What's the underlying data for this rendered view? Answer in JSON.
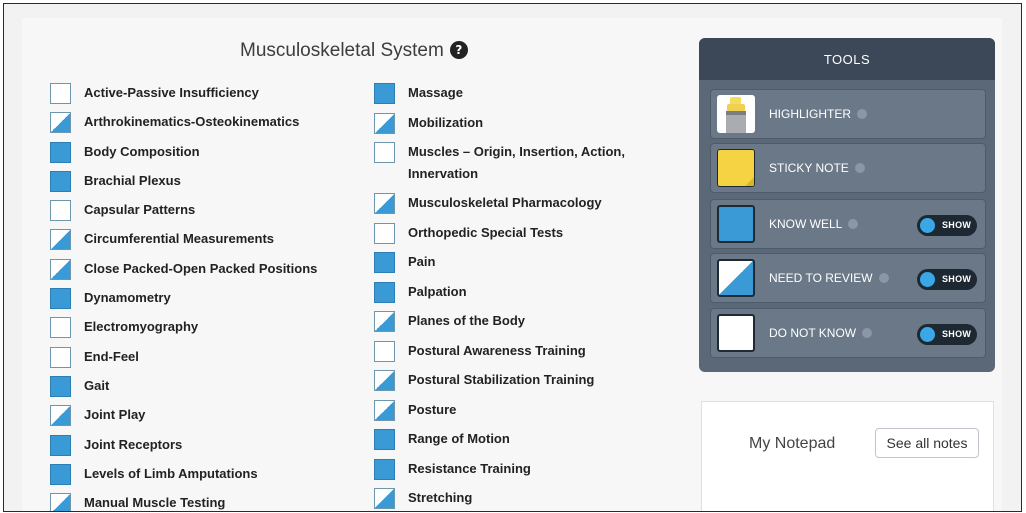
{
  "section": {
    "title": "Musculoskeletal System",
    "help_glyph": "?"
  },
  "topics_col1": [
    {
      "label": "Active-Passive Insufficiency",
      "status": "dont"
    },
    {
      "label": "Arthrokinematics-Osteokinematics",
      "status": "review"
    },
    {
      "label": "Body Composition",
      "status": "know"
    },
    {
      "label": "Brachial Plexus",
      "status": "know"
    },
    {
      "label": "Capsular Patterns",
      "status": "dont"
    },
    {
      "label": "Circumferential Measurements",
      "status": "review"
    },
    {
      "label": "Close Packed-Open Packed Positions",
      "status": "review"
    },
    {
      "label": "Dynamometry",
      "status": "know"
    },
    {
      "label": "Electromyography",
      "status": "dont"
    },
    {
      "label": "End-Feel",
      "status": "dont"
    },
    {
      "label": "Gait",
      "status": "know"
    },
    {
      "label": "Joint Play",
      "status": "review"
    },
    {
      "label": "Joint Receptors",
      "status": "know"
    },
    {
      "label": "Levels of Limb Amputations",
      "status": "know"
    },
    {
      "label": "Manual Muscle Testing",
      "status": "review"
    }
  ],
  "topics_col2": [
    {
      "label": "Massage",
      "status": "know"
    },
    {
      "label": "Mobilization",
      "status": "review"
    },
    {
      "label": "Muscles – Origin, Insertion, Action, Innervation",
      "status": "dont"
    },
    {
      "label": "Musculoskeletal Pharmacology",
      "status": "review"
    },
    {
      "label": "Orthopedic Special Tests",
      "status": "dont"
    },
    {
      "label": "Pain",
      "status": "know"
    },
    {
      "label": "Palpation",
      "status": "know"
    },
    {
      "label": "Planes of the Body",
      "status": "review"
    },
    {
      "label": "Postural Awareness Training",
      "status": "dont"
    },
    {
      "label": "Postural Stabilization Training",
      "status": "review"
    },
    {
      "label": "Posture",
      "status": "review"
    },
    {
      "label": "Range of Motion",
      "status": "know"
    },
    {
      "label": "Resistance Training",
      "status": "know"
    },
    {
      "label": "Stretching",
      "status": "review"
    }
  ],
  "tools": {
    "title": "TOOLS",
    "highlighter": "HIGHLIGHTER",
    "sticky_note": "STICKY NOTE",
    "know_well": "KNOW WELL",
    "need_to_review": "NEED TO REVIEW",
    "do_not_know": "DO NOT KNOW",
    "show_label": "SHOW"
  },
  "notepad": {
    "title": "My Notepad",
    "see_all": "See all notes"
  },
  "colors": {
    "know_blue": "#3a9ad6",
    "tools_bg": "#5a6878",
    "tools_header": "#3c4857",
    "toggle_bg": "#1e2833",
    "sticky_yellow": "#f5d342"
  }
}
